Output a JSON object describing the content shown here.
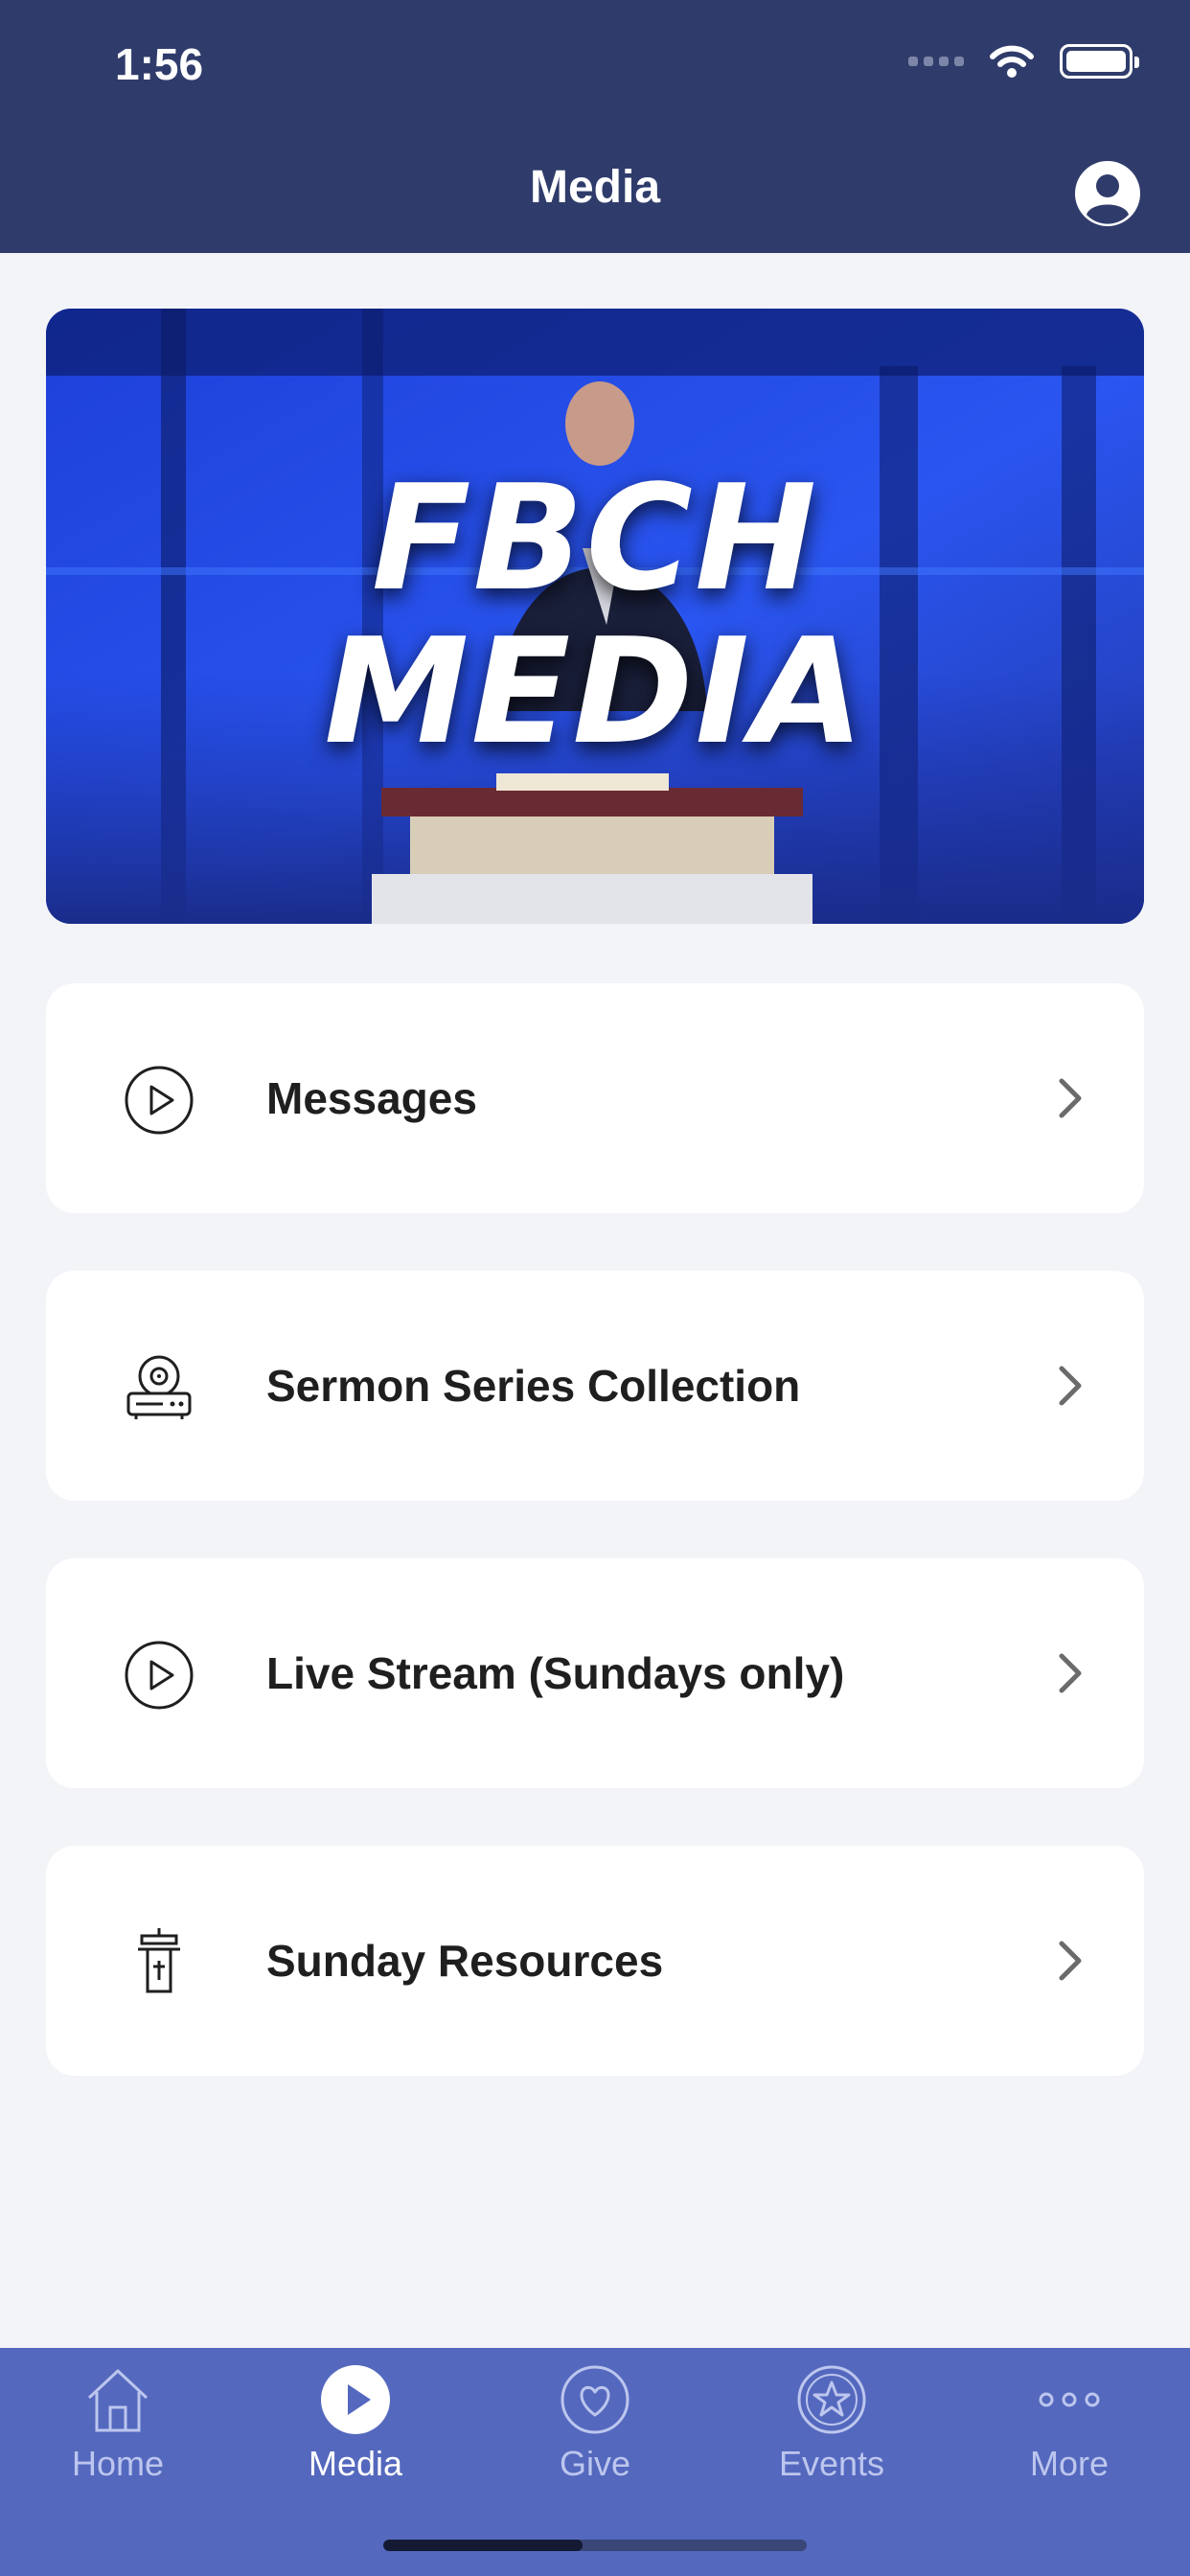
{
  "status_bar": {
    "time": "1:56"
  },
  "header": {
    "title": "Media"
  },
  "hero": {
    "title": "FBCH\nMEDIA"
  },
  "menu": [
    {
      "label": "Messages",
      "icon": "play-circle-icon"
    },
    {
      "label": "Sermon Series Collection",
      "icon": "media-player-icon"
    },
    {
      "label": "Live Stream (Sundays only)",
      "icon": "play-circle-icon"
    },
    {
      "label": "Sunday Resources",
      "icon": "pulpit-icon"
    }
  ],
  "tabs": [
    {
      "label": "Home",
      "icon": "home-icon",
      "active": false
    },
    {
      "label": "Media",
      "icon": "play-icon",
      "active": true
    },
    {
      "label": "Give",
      "icon": "heart-icon",
      "active": false
    },
    {
      "label": "Events",
      "icon": "star-icon",
      "active": false
    },
    {
      "label": "More",
      "icon": "more-icon",
      "active": false
    }
  ],
  "colors": {
    "header": "#2f3c6b",
    "background": "#f3f4f8",
    "tabbar": "#5468be",
    "hero_blue": "#1f4be6"
  }
}
